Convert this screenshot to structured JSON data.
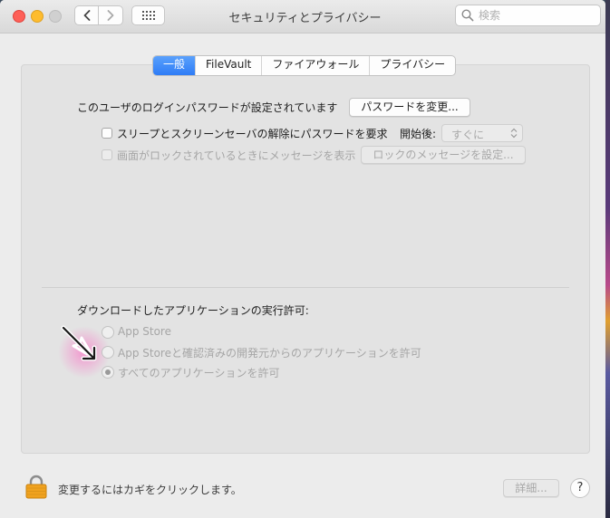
{
  "window": {
    "title": "セキュリティとプライバシー"
  },
  "search": {
    "placeholder": "検索",
    "value": ""
  },
  "tabs": [
    {
      "label": "一般",
      "active": true
    },
    {
      "label": "FileVault",
      "active": false
    },
    {
      "label": "ファイアウォール",
      "active": false
    },
    {
      "label": "プライバシー",
      "active": false
    }
  ],
  "general": {
    "password_status": "このユーザのログインパスワードが設定されています",
    "change_password_button": "パスワードを変更...",
    "require_password": {
      "label": "スリープとスクリーンセーバの解除にパスワードを要求",
      "checked": false
    },
    "delay_label": "開始後:",
    "delay_value": "すぐに",
    "lock_message": {
      "label": "画面がロックされているときにメッセージを表示",
      "checked": false,
      "enabled": false
    },
    "set_lock_message_button": "ロックのメッセージを設定..."
  },
  "downloads": {
    "heading": "ダウンロードしたアプリケーションの実行許可:",
    "options": [
      {
        "label": "App Store",
        "selected": false
      },
      {
        "label": "App Storeと確認済みの開発元からのアプリケーションを許可",
        "selected": false
      },
      {
        "label": "すべてのアプリケーションを許可",
        "selected": true
      }
    ]
  },
  "footer": {
    "lock_text": "変更するにはカギをクリックします。",
    "advanced_button": "詳細...",
    "help_button": "?"
  },
  "colors": {
    "tab_active": "#2e7cf6",
    "lock": "#f0a21f",
    "pointer_glow": "#ff5abe"
  },
  "icons": [
    "back-icon",
    "forward-icon",
    "show-all-grid-icon",
    "search-icon",
    "lock-icon",
    "chevron-updown-icon",
    "cursor-arrow-icon"
  ]
}
